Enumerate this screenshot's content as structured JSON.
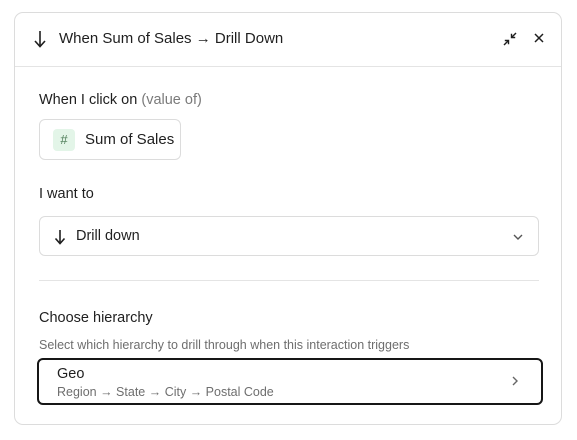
{
  "header": {
    "title": "When Sum of Sales → Drill Down"
  },
  "trigger": {
    "label": "When I click on",
    "label_muted": "(value of)",
    "field_icon": "#",
    "field_name": "Sum of Sales"
  },
  "action": {
    "label": "I want to",
    "selected": "Drill down"
  },
  "hierarchy": {
    "label": "Choose hierarchy",
    "helper": "Select which hierarchy to drill through when this interaction triggers",
    "selected_name": "Geo",
    "selected_path": "Region → State → City → Postal Code"
  },
  "colors": {
    "chip_bg": "#e3f5e8",
    "selected_border": "#161616"
  }
}
